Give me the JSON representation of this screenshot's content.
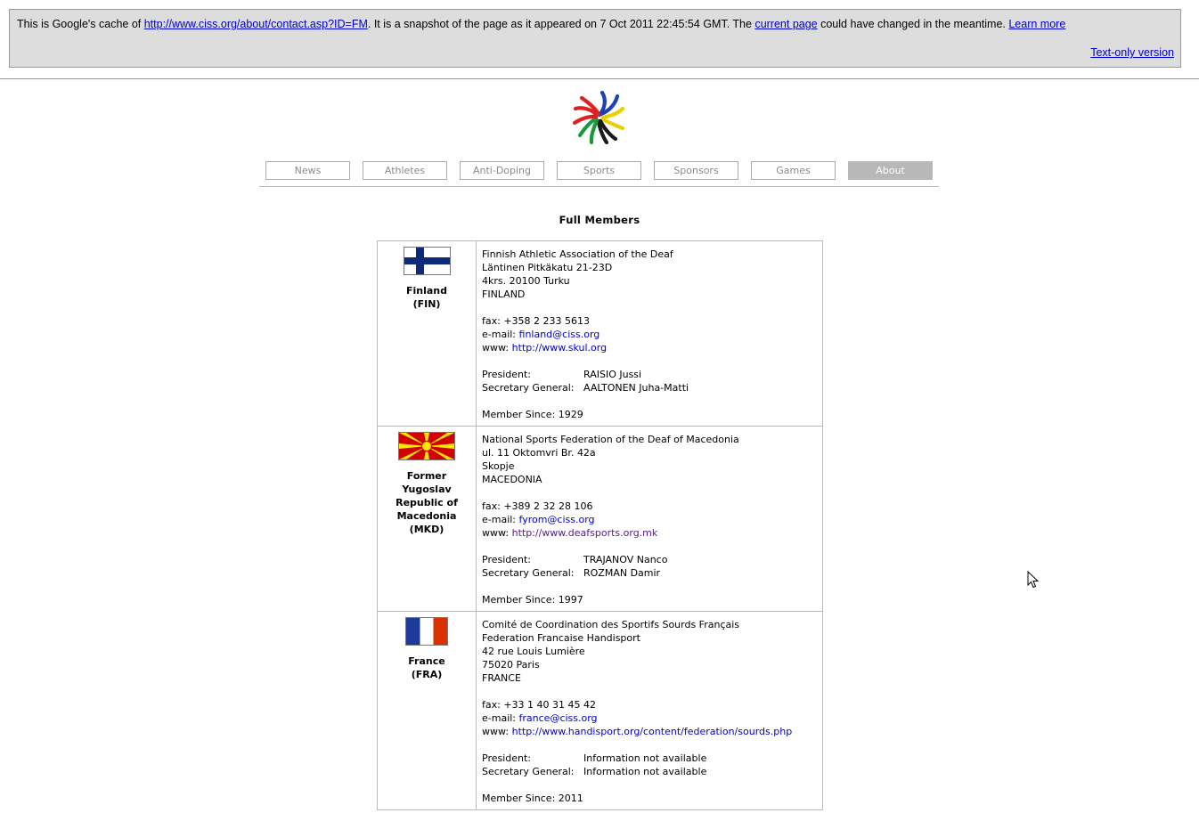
{
  "banner": {
    "prefix": "This is Google's cache of ",
    "cached_url": "http://www.ciss.org/about/contact.asp?ID=FM",
    "middle": ". It is a snapshot of the page as it appeared on 7 Oct 2011 22:45:54 GMT. The ",
    "current_page": "current page",
    "suffix": " could have changed in the meantime. ",
    "learn_more": "Learn more",
    "text_only": "Text-only version"
  },
  "nav": {
    "items": [
      "News",
      "Athletes",
      "Anti-Doping",
      "Sports",
      "Sponsors",
      "Games",
      "About"
    ],
    "active": "About"
  },
  "heading": "Full Members",
  "labels": {
    "fax": "fax: ",
    "email": "e-mail: ",
    "www": "www: ",
    "president": "President:",
    "secretary": "Secretary General:",
    "member_since": "Member Since: "
  },
  "members": [
    {
      "country": "Finland",
      "code": "(FIN)",
      "flag": "finland-flag",
      "org": [
        "Finnish Athletic Association of the Deaf"
      ],
      "address": [
        "Läntinen Pitkäkatu 21-23D",
        "4krs. 20100 Turku",
        "FINLAND"
      ],
      "fax": "+358 2 233 5613",
      "email": "finland@ciss.org",
      "www": "http://www.skul.org",
      "president": "RAISIO Jussi",
      "secretary": "AALTONEN Juha-Matti",
      "member_since": "1929"
    },
    {
      "country": "Former Yugoslav Republic of Macedonia",
      "code": "(MKD)",
      "flag": "macedonia-flag",
      "org": [
        "National Sports Federation of the Deaf of Macedonia"
      ],
      "address": [
        "ul. 11 Oktomvri Br. 42a",
        "Skopje",
        "MACEDONIA"
      ],
      "fax": "+389 2 32 28 106",
      "email": "fyrom@ciss.org",
      "www": "http://www.deafsports.org.mk",
      "president": "TRAJANOV Nanco",
      "secretary": "ROZMAN Damir",
      "member_since": "1997"
    },
    {
      "country": "France",
      "code": "(FRA)",
      "flag": "france-flag",
      "org": [
        "Comité de Coordination des Sportifs Sourds Français",
        "Federation Francaise Handisport"
      ],
      "address": [
        "42 rue Louis Lumière",
        "75020 Paris",
        "FRANCE"
      ],
      "fax": "+33 1 40 31 45 42",
      "email": "france@ciss.org",
      "www": "http://www.handisport.org/content/federation/sourds.php",
      "president": "Information not available",
      "secretary": "Information not available",
      "member_since": "2011"
    }
  ]
}
